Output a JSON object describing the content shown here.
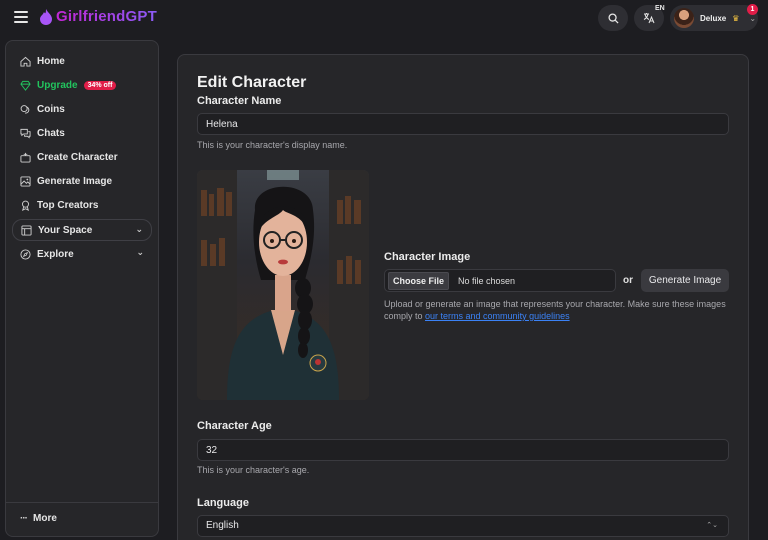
{
  "header": {
    "brand": "GirlfriendGPT",
    "language_code": "EN",
    "user_label": "Deluxe",
    "notification_count": "1"
  },
  "sidebar": {
    "items": [
      {
        "label": "Home",
        "icon": "home-icon"
      },
      {
        "label": "Upgrade",
        "icon": "gem-icon",
        "badge": "34% off"
      },
      {
        "label": "Coins",
        "icon": "coins-icon"
      },
      {
        "label": "Chats",
        "icon": "chats-icon"
      },
      {
        "label": "Create Character",
        "icon": "create-icon"
      },
      {
        "label": "Generate Image",
        "icon": "image-icon"
      },
      {
        "label": "Top Creators",
        "icon": "award-icon"
      },
      {
        "label": "Your Space",
        "icon": "space-icon"
      },
      {
        "label": "Explore",
        "icon": "compass-icon"
      }
    ],
    "more_label": "More"
  },
  "form": {
    "title": "Edit Character",
    "name_label": "Character Name",
    "name_value": "Helena",
    "name_help": "This is your character's display name.",
    "image_label": "Character Image",
    "choose_file": "Choose File",
    "no_file": "No file chosen",
    "or_text": "or",
    "generate_button": "Generate Image",
    "image_help": "Upload or generate an image that represents your character. Make sure these images comply to",
    "image_help_link": "our terms and community guidelines",
    "age_label": "Character Age",
    "age_value": "32",
    "age_help": "This is your character's age.",
    "language_label": "Language",
    "language_value": "English"
  },
  "colors": {
    "brand_gradient_start": "#c026d3",
    "brand_gradient_end": "#8b5cf6",
    "upgrade_green": "#22c55e",
    "badge_red": "#e11d48",
    "link_blue": "#3b82f6"
  }
}
